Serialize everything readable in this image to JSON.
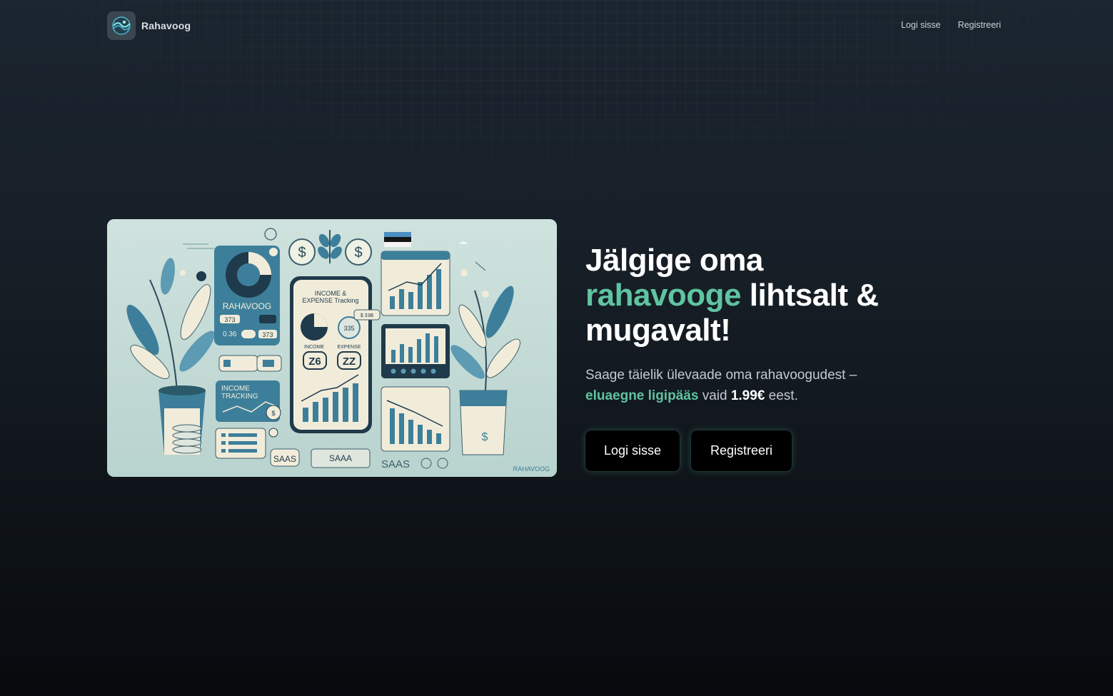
{
  "brand": {
    "name": "Rahavoog",
    "logo_icon": "wave-globe-icon"
  },
  "nav": {
    "login": "Logi sisse",
    "register": "Registreeri"
  },
  "hero": {
    "title_line1": "Jälgige oma",
    "title_accent": "rahavooge",
    "title_rest": "lihtsalt &",
    "title_line3": "mugavalt!",
    "subtitle_part1": "Saage täielik ülevaade oma rahavoogudest –",
    "subtitle_accent": "eluaegne ligipääs",
    "subtitle_mid": "vaid",
    "price": "1.99€",
    "subtitle_end": "eest.",
    "login_button": "Logi sisse",
    "register_button": "Registreeri"
  },
  "illustration": {
    "card_title": "RAHAVOOG",
    "card_values": [
      "373",
      "0.36",
      "373"
    ],
    "phone_title_1": "INCOME &",
    "phone_title_2": "EXPENSE Tracking",
    "income_label": "INCOME",
    "expense_label": "EXPENSE",
    "income_value": "Z6",
    "expense_value": "ZZ",
    "badge": "335",
    "mini_badge": "$ 33B",
    "income_tracking_1": "INCOME",
    "income_tracking_2": "TRACKING",
    "saas_1": "SAAS",
    "saas_2": "SAAA",
    "saas_3": "SAAS",
    "watermark": "RAHAVOOG",
    "colors": {
      "bg": "#c7dcd8",
      "teal": "#3d7f9a",
      "dark": "#1f3a4a",
      "cream": "#f1ecda"
    }
  },
  "colors": {
    "accent": "#5fc4a0",
    "button_bg": "#000000"
  }
}
